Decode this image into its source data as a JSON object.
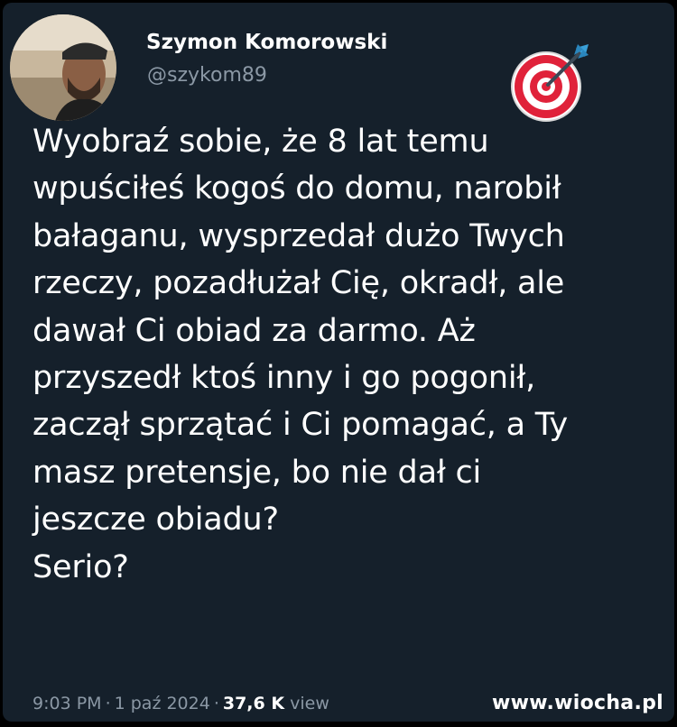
{
  "tweet": {
    "author_name": "Szymon Komorowski",
    "author_handle": "@szykom89",
    "emoji_icon": "direct-hit-target-icon",
    "text_lines": [
      "Wyobraź sobie, że 8 lat temu",
      "wpuściłeś kogoś do domu, narobił",
      "bałaganu, wysprzedał dużo Twych",
      "rzeczy, pozadłużał Cię, okradł, ale",
      "dawał Ci obiad za darmo. Aż",
      "przyszedł ktoś inny i go pogonił,",
      "zaczął sprzątać i Ci pomagać, a Ty",
      "masz pretensje, bo nie dał ci",
      "jeszcze obiadu?",
      "Serio?"
    ],
    "time": "9:03 PM",
    "separator": "·",
    "date": "1 paź 2024",
    "views_count": "37,6 K",
    "views_label": "view"
  },
  "watermark": "www.wiocha.pl",
  "colors": {
    "background": "#15202b",
    "text": "#ffffff",
    "secondary": "#8b98a5"
  }
}
